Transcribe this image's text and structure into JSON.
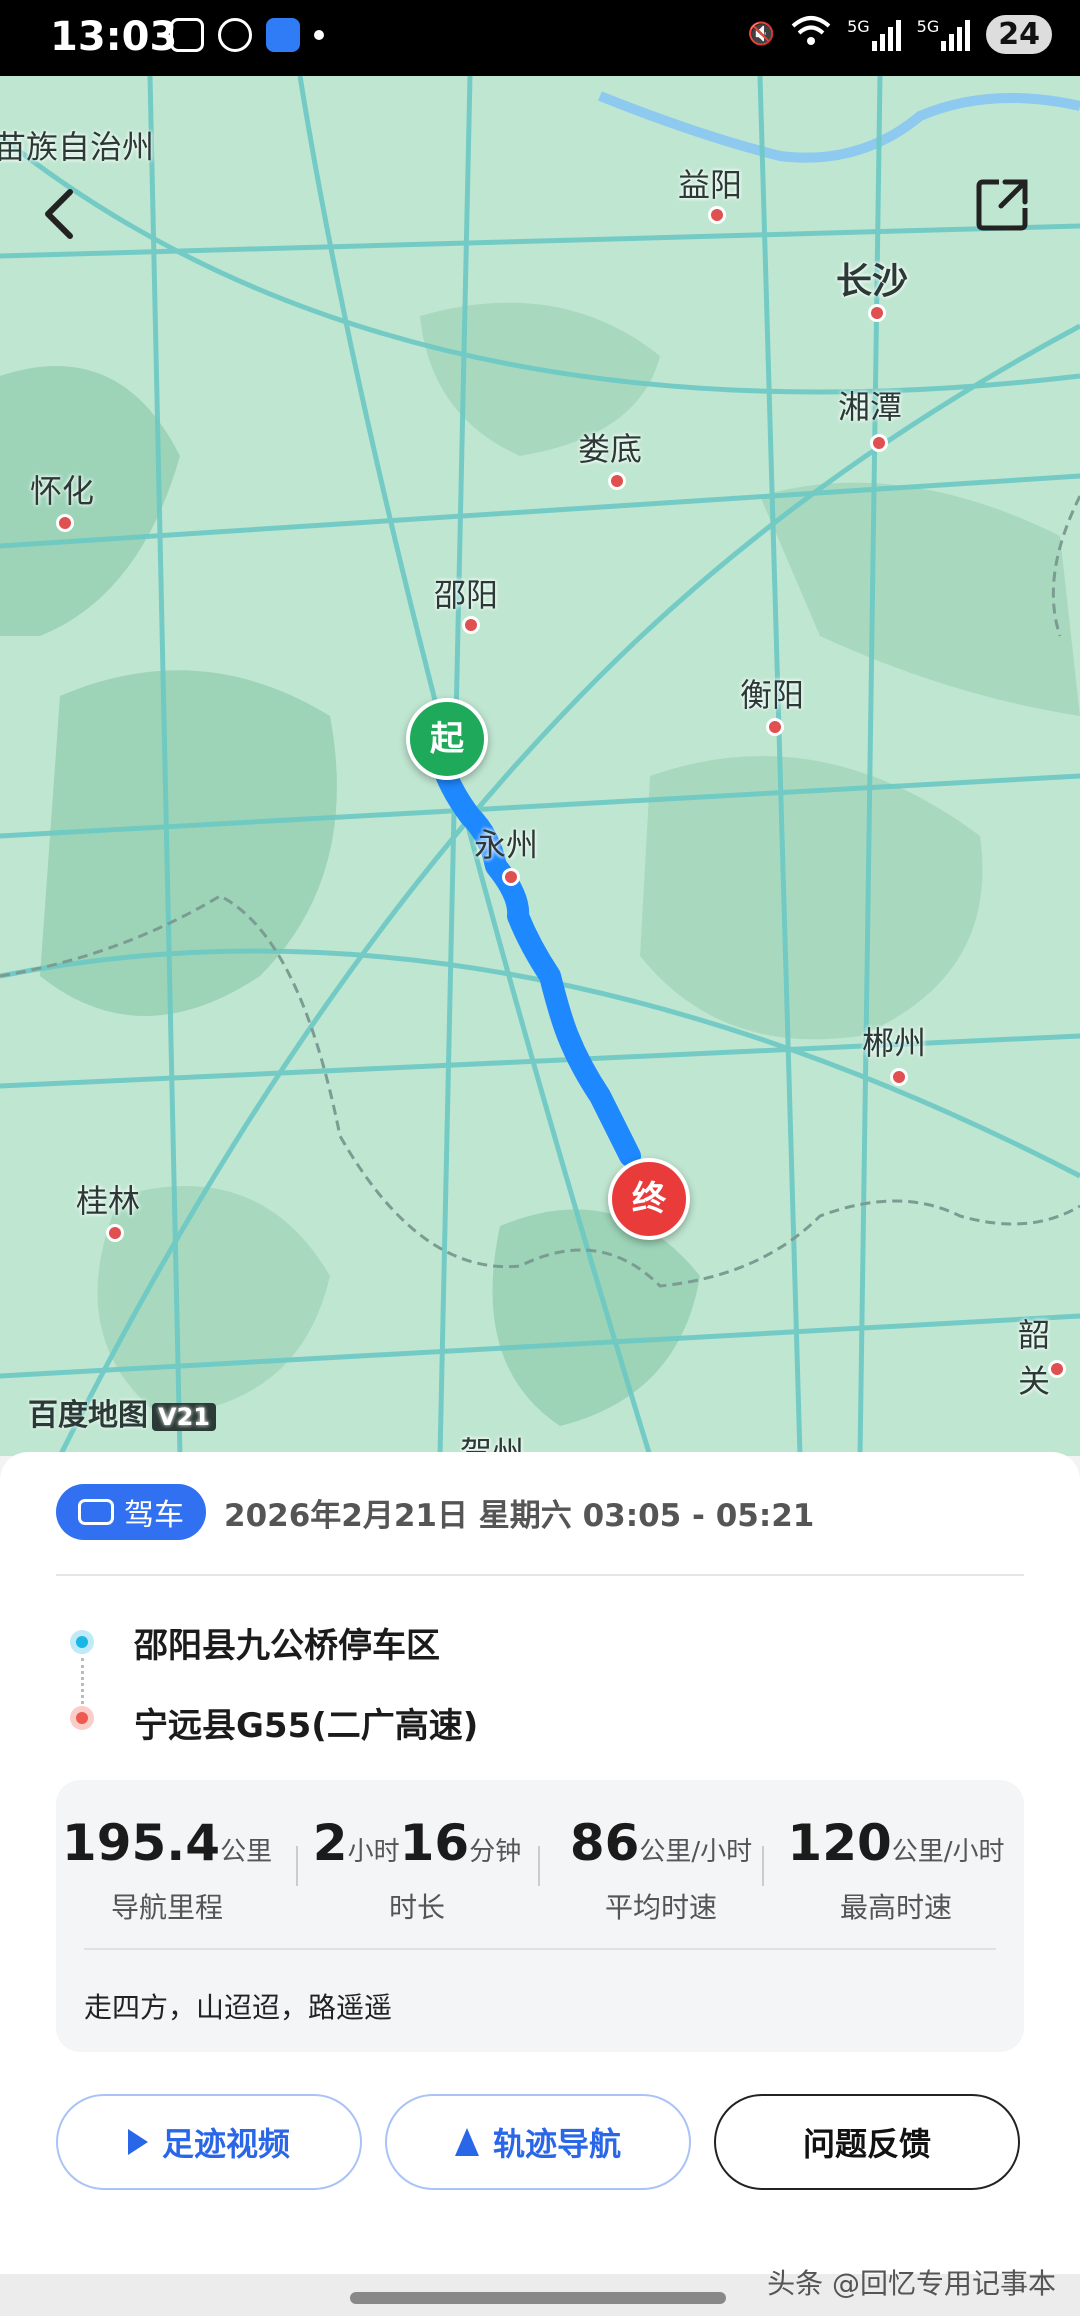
{
  "status_bar": {
    "time": "13:03",
    "battery": "24",
    "net1": "5G",
    "net2": "5G"
  },
  "map": {
    "cities": [
      {
        "name": "苗族自治州"
      },
      {
        "name": "益阳"
      },
      {
        "name": "长沙"
      },
      {
        "name": "湘潭"
      },
      {
        "name": "娄底"
      },
      {
        "name": "怀化"
      },
      {
        "name": "邵阳"
      },
      {
        "name": "衡阳"
      },
      {
        "name": "永州"
      },
      {
        "name": "郴州"
      },
      {
        "name": "桂林"
      },
      {
        "name": "韶关"
      },
      {
        "name": "贺州"
      }
    ],
    "start_pin": "起",
    "end_pin": "终",
    "logo": "百度地图",
    "logo_version": "V21"
  },
  "route": {
    "mode": "驾车",
    "time_range": "2026年2月21日 星期六 03:05 - 05:21",
    "start": "邵阳县九公桥停车区",
    "end": "宁远县G55(二广高速)"
  },
  "stats": {
    "distance": {
      "value": "195.4",
      "unit": "公里",
      "label": "导航里程"
    },
    "duration": {
      "h": "2",
      "h_unit": "小时",
      "m": "16",
      "m_unit": "分钟",
      "label": "时长"
    },
    "avg_speed": {
      "value": "86",
      "unit": "公里/小时",
      "label": "平均时速"
    },
    "max_speed": {
      "value": "120",
      "unit": "公里/小时",
      "label": "最高时速"
    },
    "slogan": "走四方，山迢迢，路遥遥"
  },
  "actions": {
    "video": "足迹视频",
    "track_nav": "轨迹导航",
    "feedback": "问题反馈"
  },
  "watermark": "头条 @回忆专用记事本"
}
